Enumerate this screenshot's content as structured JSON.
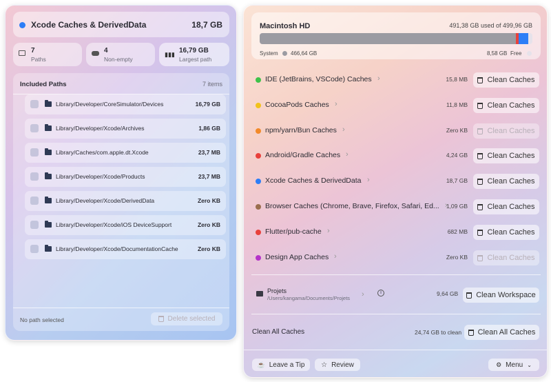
{
  "left": {
    "header": {
      "title": "Xcode Caches & DerivedData",
      "size": "18,7 GB",
      "accent": "#2d7ef7"
    },
    "stats": [
      {
        "value": "7",
        "label": "Paths"
      },
      {
        "value": "4",
        "label": "Non-empty"
      },
      {
        "value": "16,79 GB",
        "label": "Largest path"
      }
    ],
    "included": {
      "title": "Included Paths",
      "count": "7 items"
    },
    "paths": [
      {
        "path": "Library/Developer/CoreSimulator/Devices",
        "size": "16,79 GB"
      },
      {
        "path": "Library/Developer/Xcode/Archives",
        "size": "1,86 GB"
      },
      {
        "path": "Library/Caches/com.apple.dt.Xcode",
        "size": "23,7 MB"
      },
      {
        "path": "Library/Developer/Xcode/Products",
        "size": "23,7 MB"
      },
      {
        "path": "Library/Developer/Xcode/DerivedData",
        "size": "Zero KB"
      },
      {
        "path": "Library/Developer/Xcode/iOS DeviceSupport",
        "size": "Zero KB"
      },
      {
        "path": "Library/Developer/Xcode/DocumentationCache",
        "size": "Zero KB"
      }
    ],
    "footer": {
      "status": "No path selected",
      "delete_label": "Delete selected"
    }
  },
  "right": {
    "disk": {
      "name": "Macintosh HD",
      "usage": "491,38 GB used of 499,96 GB",
      "used_fraction": 0.983,
      "system_label": "System",
      "system_size": "466,64 GB",
      "free_size": "8,58 GB",
      "free_label": "Free"
    },
    "caches": [
      {
        "name": "IDE (JetBrains, VSCode) Caches",
        "size": "15,8 MB",
        "color": "#3ec24a",
        "button": "Clean Caches",
        "enabled": true
      },
      {
        "name": "CocoaPods Caches",
        "size": "11,8 MB",
        "color": "#f1c21b",
        "button": "Clean Caches",
        "enabled": true
      },
      {
        "name": "npm/yarn/Bun Caches",
        "size": "Zero KB",
        "color": "#f28a2a",
        "button": "Clean Caches",
        "enabled": false
      },
      {
        "name": "Android/Gradle Caches",
        "size": "4,24 GB",
        "color": "#e8413c",
        "button": "Clean Caches",
        "enabled": true
      },
      {
        "name": "Xcode Caches & DerivedData",
        "size": "18,7 GB",
        "color": "#2d7ef7",
        "button": "Clean Caches",
        "enabled": true
      },
      {
        "name": "Browser Caches (Chrome, Brave, Firefox, Safari, Ed...",
        "size": "1,09 GB",
        "color": "#9a6e4e",
        "button": "Clean Caches",
        "enabled": true
      },
      {
        "name": "Flutter/pub-cache",
        "size": "682 MB",
        "color": "#e8413c",
        "button": "Clean Caches",
        "enabled": true
      },
      {
        "name": "Design App Caches",
        "size": "Zero KB",
        "color": "#b533c9",
        "button": "Clean Caches",
        "enabled": false
      }
    ],
    "workspace": {
      "name": "Projets",
      "path": "/Users/kangama/Documents/Projets",
      "size": "9,64 GB",
      "button": "Clean Workspace"
    },
    "clean_all": {
      "label": "Clean All Caches",
      "summary": "24,74 GB to clean",
      "button": "Clean All Caches"
    },
    "bottom": {
      "tip": "Leave a Tip",
      "review": "Review",
      "menu": "Menu"
    }
  }
}
